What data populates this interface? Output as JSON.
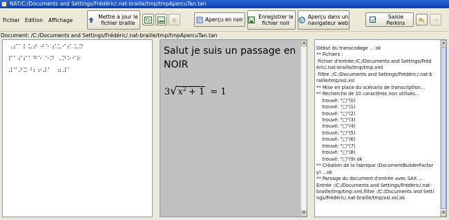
{
  "window": {
    "title": "NAT/C:/Documents and Settings/Frédéric/.nat-braille/tmp/tmpApercuTan.tan"
  },
  "menu": {
    "file": "Fichier",
    "edit": "Edition",
    "display": "Affichage"
  },
  "toolbar": {
    "update_braille": "Mettre à jour le fichier braille",
    "preview_black": "Aperçu en noir",
    "save_black": "Enregistrer le fichier noir",
    "preview_browser": "Aperçu dans un navigateur web",
    "perkins_label": "Saisie Perkins",
    "perkins_checked": true
  },
  "document_path": "Document: /C:/Documents and Settings/Frédéric/.nat-braille/tmp/tmpApercuTan.tan",
  "braille": {
    "lines": [
      "⠠⠎⠁⠇⠥⠞ ⠚⠑ ⠎⠥⠊⠎ ⠥⠝",
      "⠏⠁⠎⠎⠁⠛⠑ ⠑⠝ ⠠⠝⠕⠊⠗",
      "",
      "⠼⠉⠜⠭⠘⠆⠖⠼⠁⠀⠶⠼⠁"
    ]
  },
  "noir": {
    "text": "Salut je suis un passage en NOIR",
    "formula_coef": "3",
    "formula_var": "x",
    "formula_exp": "2",
    "formula_rest": "+ 1",
    "formula_rhs": "= 1"
  },
  "log": {
    "lines": [
      "Début du transcodage ... ok",
      "** Fichiers :",
      " Fichier d'entrée:/C:/Documents and Settings/Fréd",
      "éric/.nat-braille/tmp/tmp.xml",
      " Filtre :/C:/Documents and Settings/Frédéric/.nat-b",
      "raille/tmp/xsl.xsl",
      "** Mise en place du scénario de transcription...",
      "** Recherche de 10 caractères non utilisés...",
      "    trouvé: \"□\"(0)",
      "    trouvé: \"□\"(1)",
      "    trouvé: \"□\"(2)",
      "    trouvé: \"□\"(3)",
      "    trouvé: \"□\"(4)",
      "    trouvé: \"□\"(5)",
      "    trouvé: \"□\"(6)",
      "    trouvé: \"□\"(7)",
      "    trouvé: \"□\"(8)",
      "    trouvé: \"□\"(9) ok",
      "** Création de la fabrique (DocumentBuilderFactor",
      "y) ...ok",
      "** Parsage du document d'entrée avec SAX ...",
      "Entrée :/C:/Documents and Settings/Frédéric/.nat-",
      "braille/tmp/tmp.xml,filtre :/C:/Documents and Setti",
      "ngs/Frédéric/.nat-braille/tmp/xsl.xsl,ok"
    ]
  }
}
